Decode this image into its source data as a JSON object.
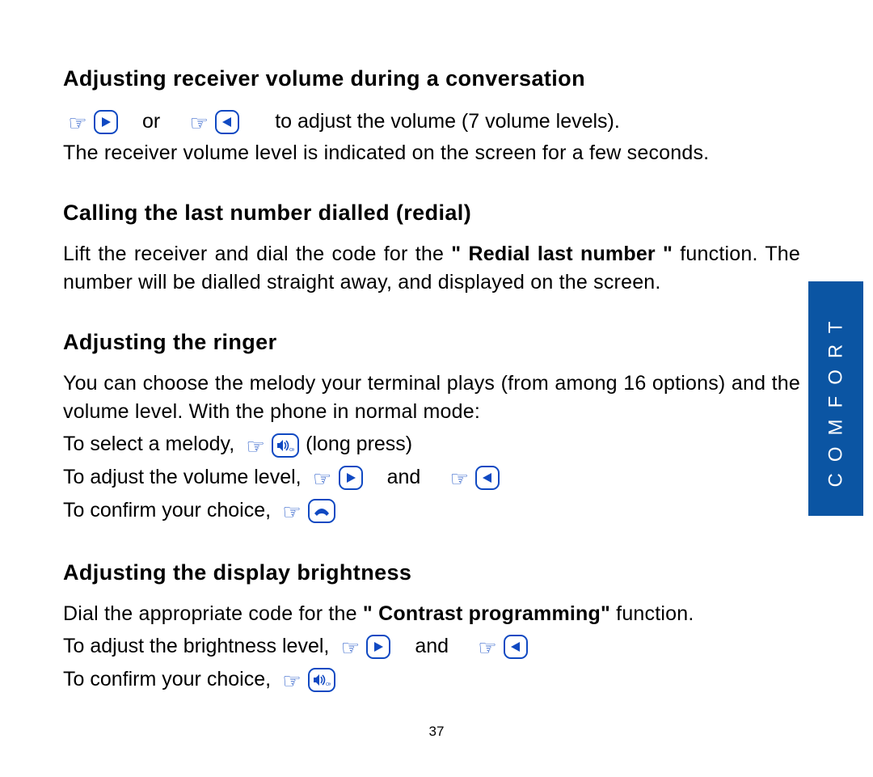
{
  "sideTab": "COMFORT",
  "pageNumber": "37",
  "s1": {
    "heading": "Adjusting receiver volume during a conversation",
    "or": "or",
    "tail": "to adjust the volume (7 volume levels).",
    "line2": "The receiver volume level is indicated on the screen for a few seconds."
  },
  "s2": {
    "heading": "Calling the last number dialled (redial)",
    "p1a": "Lift the receiver and dial the code for the ",
    "p1bold": "\" Redial last number \"",
    "p1b": " function. The number will be dialled straight away, and displayed on the screen."
  },
  "s3": {
    "heading": "Adjusting the ringer",
    "intro": "You can choose the melody your terminal plays (from among 16 options) and the volume level.   With the phone in normal mode:",
    "l1a": "To select a melody,",
    "l1b": "(long press)",
    "l2a": "To adjust the volume level,",
    "and": "and",
    "l3a": "To confirm your choice,"
  },
  "s4": {
    "heading": "Adjusting the display brightness",
    "p1a": "Dial the appropriate code for the ",
    "p1bold": "\" Contrast programming\"",
    "p1b": " function.",
    "l2a": "To adjust the brightness level,",
    "and": "and",
    "l3a": "To confirm your choice,"
  }
}
